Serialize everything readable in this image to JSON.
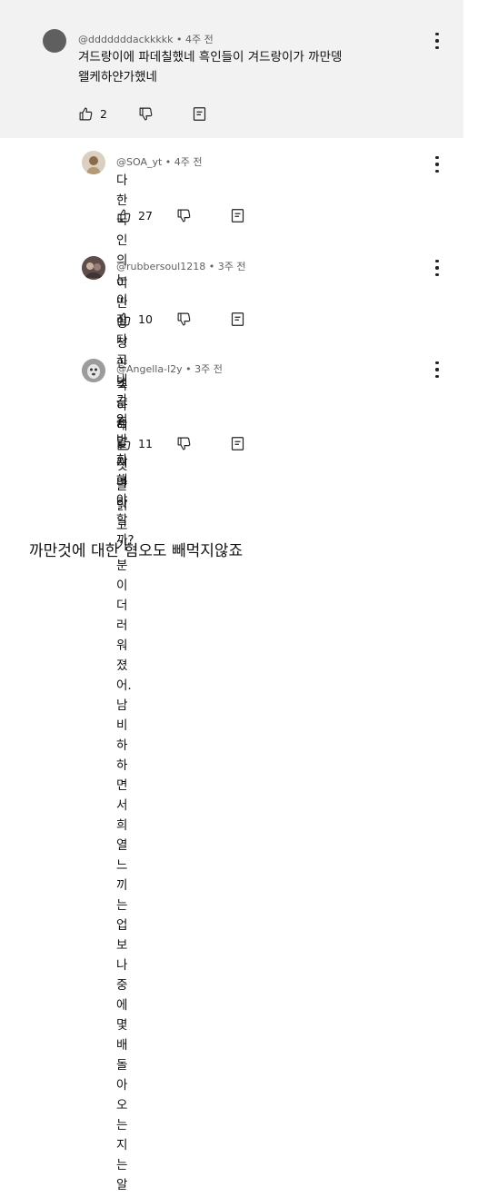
{
  "comments": [
    {
      "author": "@dddddddackkkkk",
      "time": "4주 전",
      "lines": [
        "겨드랑이에 파데칠했네 흑인들이 겨드랑이가 까만뎅",
        "왤케하얀가했네"
      ],
      "likes": "2"
    },
    {
      "author": "@SOA_yt",
      "time": "4주 전",
      "lines": [
        "다 한국인의 눈이 작다고 내가 일반화해야 할까?"
      ],
      "likes": "27"
    },
    {
      "author": "@rubbersoul1218",
      "time": "3주 전",
      "lines": [
        "이딴 멍청한 댓글 좀 달지 마라"
      ],
      "likes": "10"
    },
    {
      "author": "@Angella-l2y",
      "time": "3주 전",
      "lines": [
        "축하해~ 댓글읽고 기분이 더러워졌어. 남 비하하면서",
        "희열느끼는 업보 나중에 몇배 돌아오는지는 알지?"
      ],
      "likes": "11"
    }
  ],
  "separator": "•",
  "footer_text": "까만것에 대한 혐오도 빼먹지않죠"
}
